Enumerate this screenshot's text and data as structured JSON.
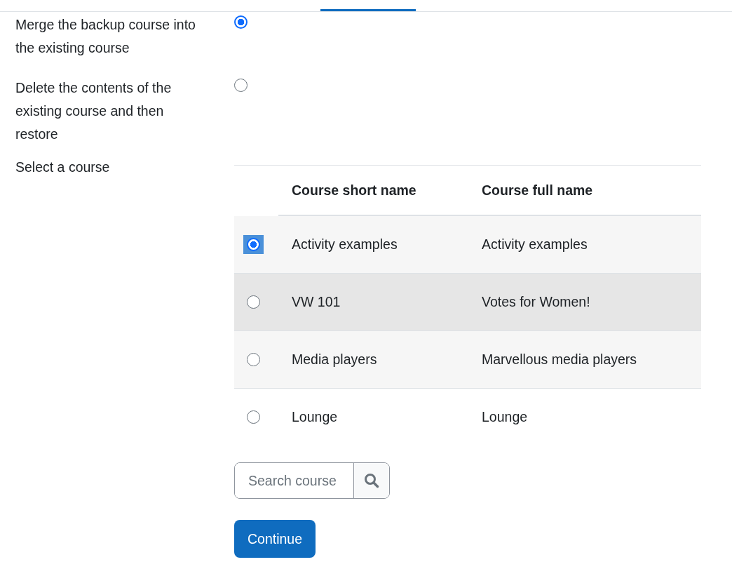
{
  "restore_options": [
    {
      "label": "Merge the backup course into the existing course",
      "selected": true
    },
    {
      "label": "Delete the contents of the existing course and then restore",
      "selected": false
    }
  ],
  "course_select": {
    "label": "Select a course",
    "columns": [
      "Course short name",
      "Course full name"
    ],
    "rows": [
      {
        "short_name": "Activity examples",
        "full_name": "Activity examples",
        "selected": true,
        "hovered": false
      },
      {
        "short_name": "VW 101",
        "full_name": "Votes for Women!",
        "selected": false,
        "hovered": true
      },
      {
        "short_name": "Media players",
        "full_name": "Marvellous media players",
        "selected": false,
        "hovered": false
      },
      {
        "short_name": "Lounge",
        "full_name": "Lounge",
        "selected": false,
        "hovered": false
      }
    ]
  },
  "search": {
    "placeholder": "Search course"
  },
  "continue_button": "Continue"
}
